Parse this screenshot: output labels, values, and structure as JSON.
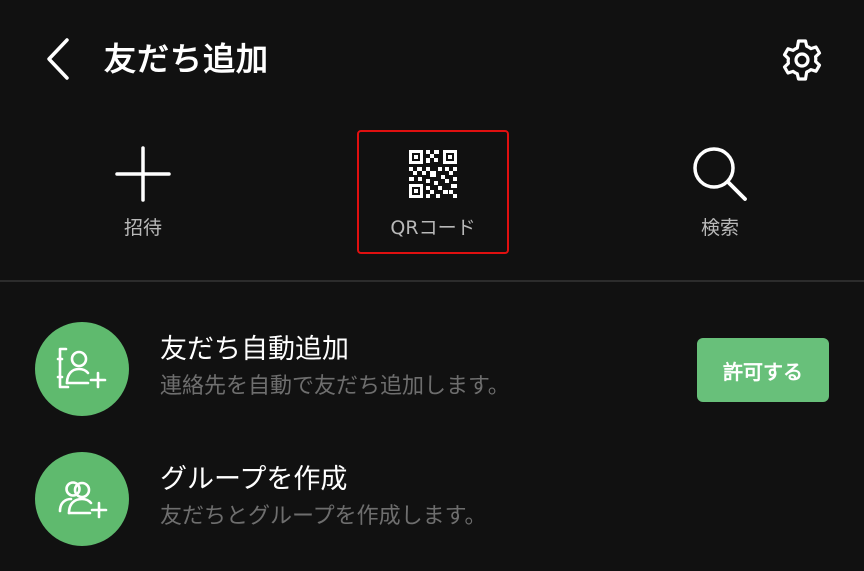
{
  "header": {
    "title": "友だち追加",
    "back_icon": "chevron-left-icon",
    "settings_icon": "gear-icon"
  },
  "actions": [
    {
      "label": "招待",
      "icon": "plus-icon"
    },
    {
      "label": "QRコード",
      "icon": "qr-code-icon",
      "highlighted": true
    },
    {
      "label": "検索",
      "icon": "search-icon"
    }
  ],
  "list": [
    {
      "title": "友だち自動追加",
      "subtitle": "連絡先を自動で友だち追加します。",
      "icon": "contact-add-icon",
      "button_label": "許可する"
    },
    {
      "title": "グループを作成",
      "subtitle": "友だちとグループを作成します。",
      "icon": "group-add-icon"
    }
  ],
  "colors": {
    "background": "#111111",
    "accent_green": "#5fba6e",
    "highlight_border": "#e01010",
    "secondary_text": "#6e6e6e"
  }
}
